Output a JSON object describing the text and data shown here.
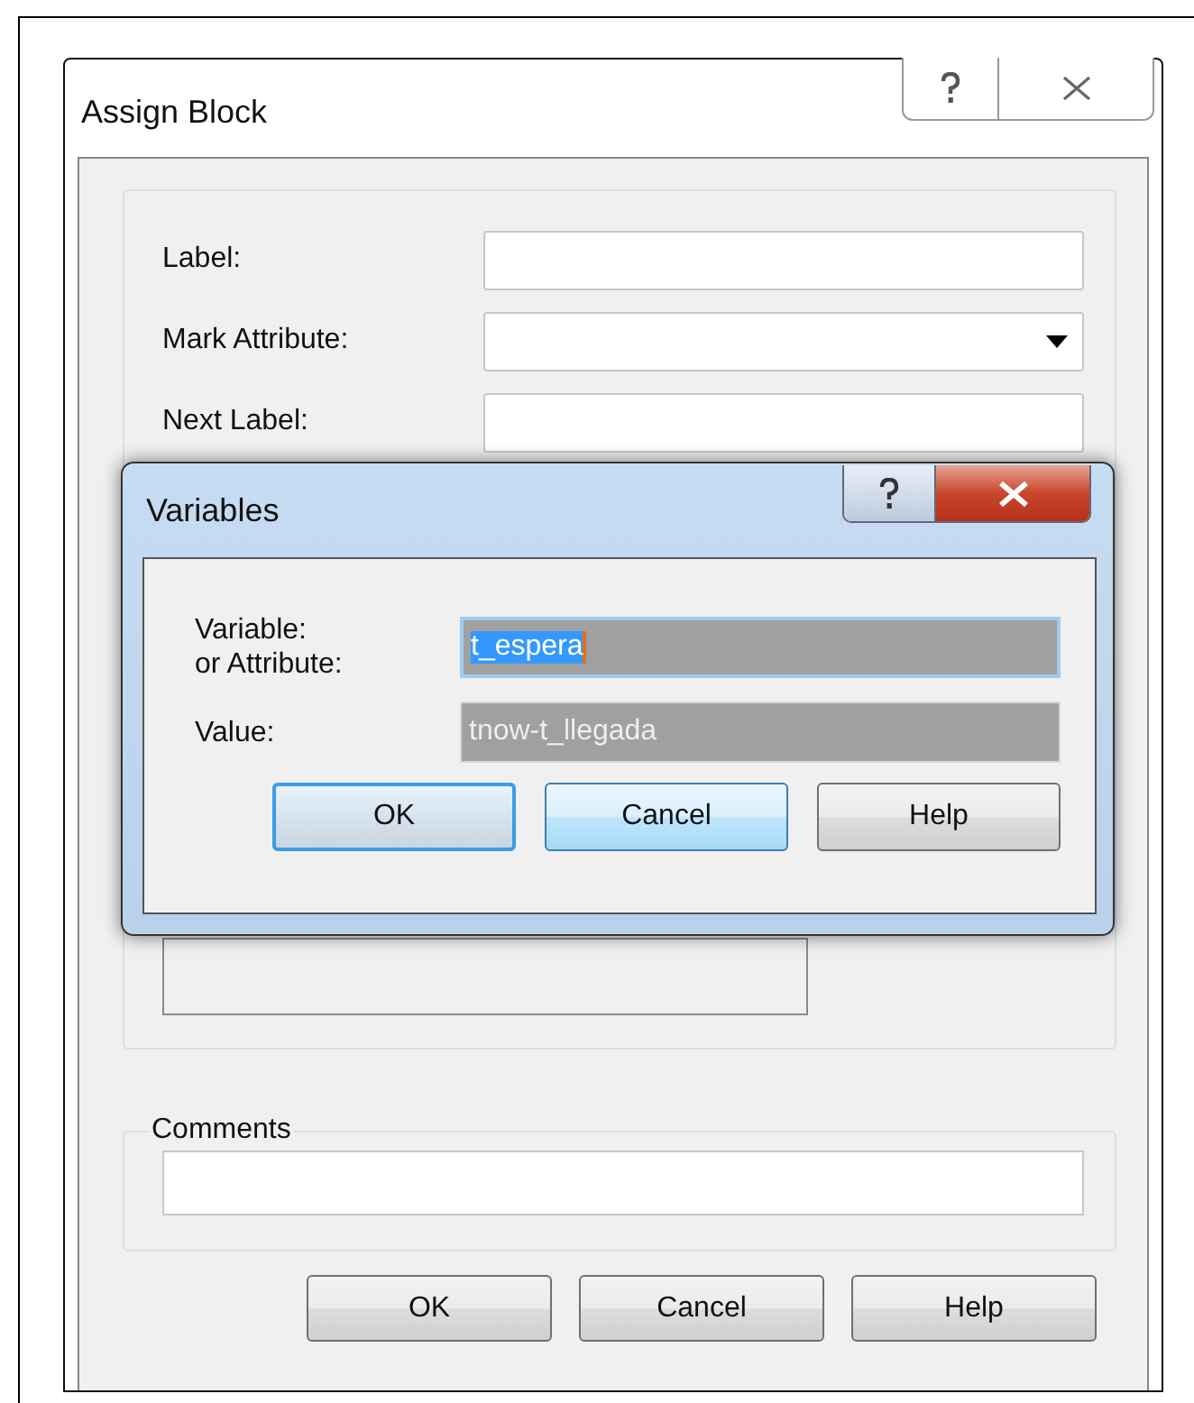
{
  "window": {
    "title": "Assign Block"
  },
  "fields": [
    {
      "label": "Label:",
      "kind": "text"
    },
    {
      "label": "Mark Attribute:",
      "kind": "dropdown"
    },
    {
      "label": "Next Label:",
      "kind": "text"
    }
  ],
  "comments": {
    "title": "Comments"
  },
  "buttons": [
    {
      "label": "OK"
    },
    {
      "label": "Cancel"
    },
    {
      "label": "Help"
    }
  ],
  "dialog": {
    "title": "Variables",
    "fields": [
      {
        "label": "Variable:\nor Attribute:",
        "value": "t_espera",
        "focused": true,
        "text_selected": true
      },
      {
        "label": "Value:",
        "value": "tnow-t_llegada",
        "focused": false,
        "text_selected": false
      }
    ],
    "buttons": [
      {
        "label": "OK",
        "default": true,
        "hover": false
      },
      {
        "label": "Cancel",
        "default": false,
        "hover": true
      },
      {
        "label": "Help",
        "default": false,
        "hover": false
      }
    ]
  }
}
